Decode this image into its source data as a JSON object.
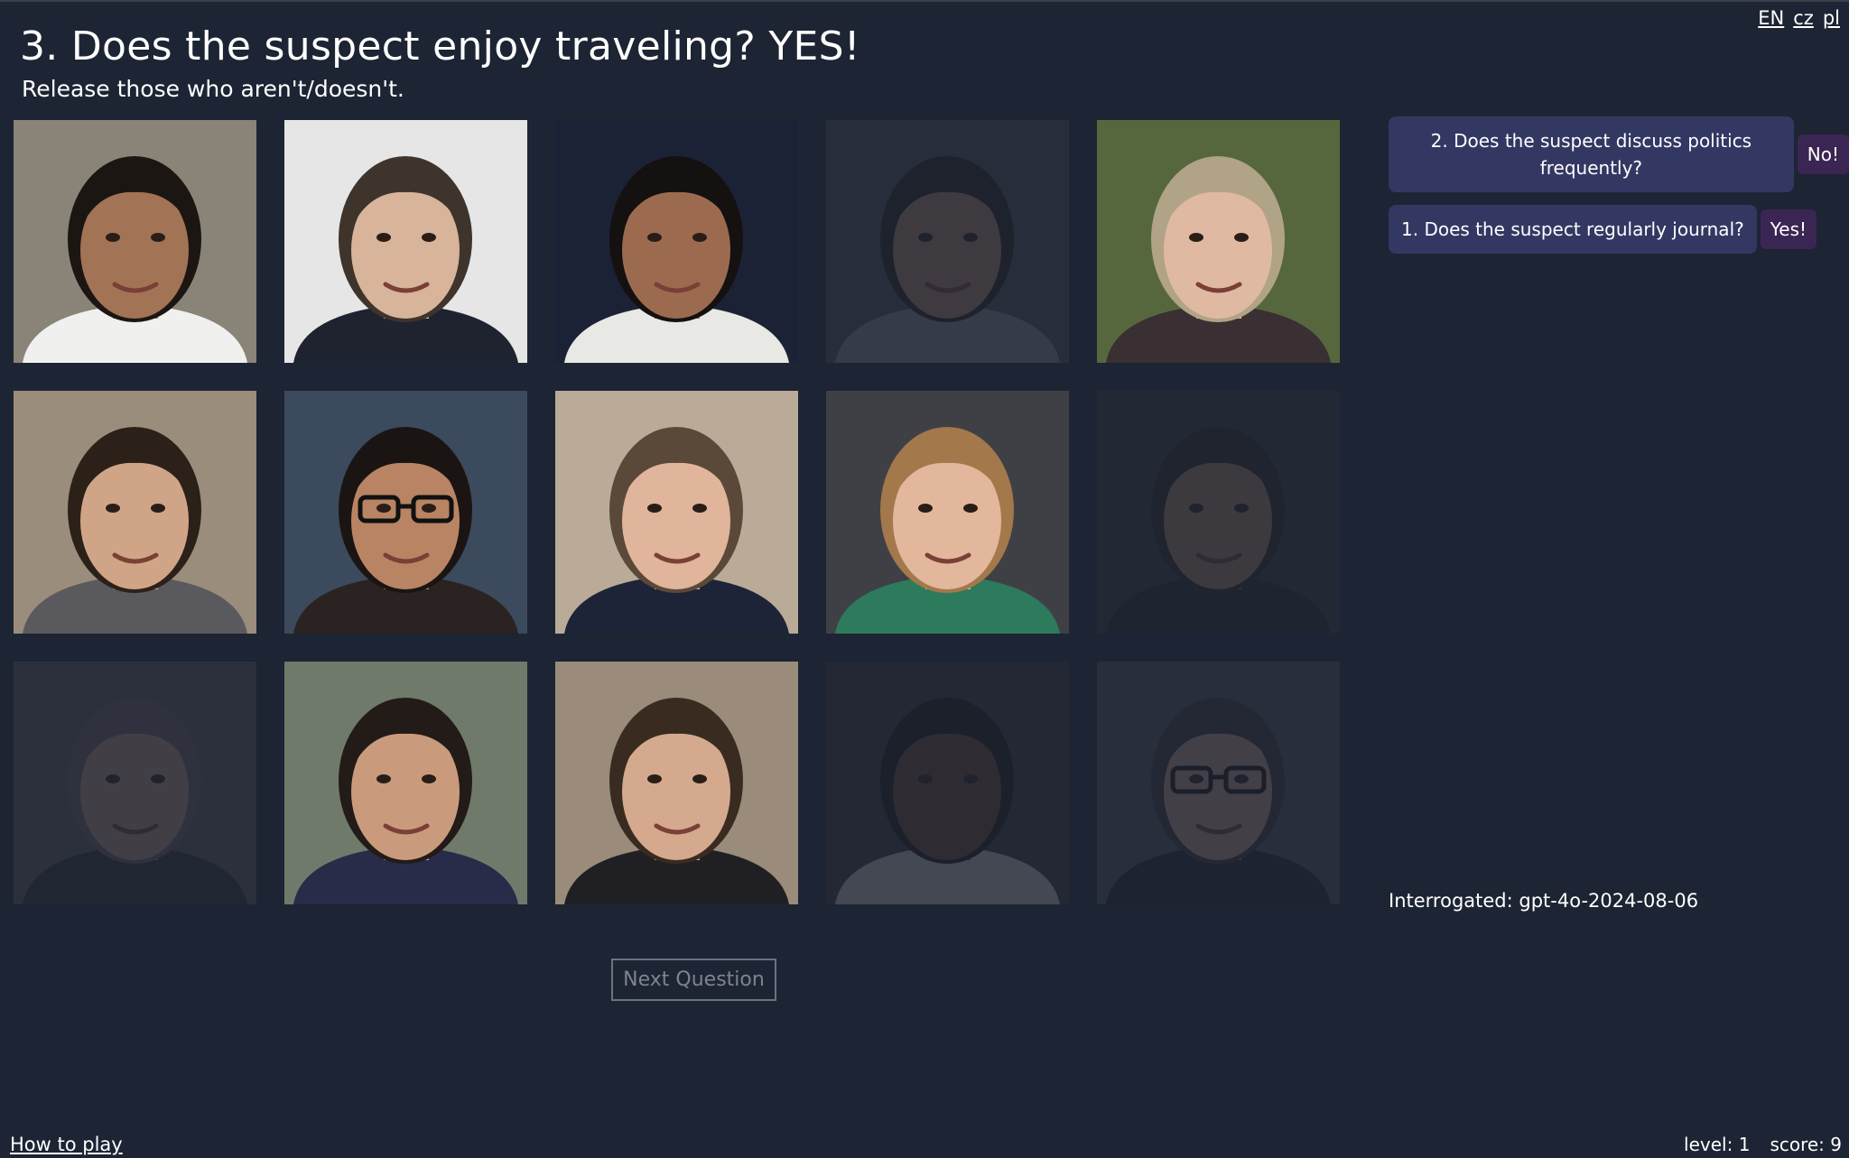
{
  "languages": [
    "EN",
    "cz",
    "pl"
  ],
  "question": {
    "title": "3. Does the suspect enjoy traveling?  YES!",
    "instruction": "Release those who aren't/doesn't."
  },
  "suspects": [
    {
      "released": false,
      "bg": "#8a8478",
      "skin": "#a27355",
      "hair": "#1c1613",
      "shirt": "#f0f0ee",
      "glasses": false
    },
    {
      "released": false,
      "bg": "#e6e6e6",
      "skin": "#d7b49a",
      "hair": "#3e342c",
      "shirt": "#1f2330",
      "glasses": false
    },
    {
      "released": false,
      "bg": "#1c2235",
      "skin": "#9c6b4f",
      "hair": "#141110",
      "shirt": "#e8e8e4",
      "glasses": false
    },
    {
      "released": true,
      "bg": "#4a4e56",
      "skin": "#b08a6c",
      "hair": "#1f1c1a",
      "shirt": "#8a8d92",
      "glasses": false
    },
    {
      "released": false,
      "bg": "#56673e",
      "skin": "#e0b9a2",
      "hair": "#b0a386",
      "shirt": "#3a2f33",
      "glasses": false
    },
    {
      "released": false,
      "bg": "#9a8d7b",
      "skin": "#d0a587",
      "hair": "#2c2119",
      "shirt": "#5a5a5e",
      "glasses": false
    },
    {
      "released": false,
      "bg": "#3b4a5c",
      "skin": "#b88463",
      "hair": "#1a1513",
      "shirt": "#2a2322",
      "glasses": true
    },
    {
      "released": false,
      "bg": "#b9ab98",
      "skin": "#e0b59b",
      "hair": "#5a4939",
      "shirt": "#1d2438",
      "glasses": false
    },
    {
      "released": false,
      "bg": "#3f4045",
      "skin": "#e2b79b",
      "hair": "#a3784b",
      "shirt": "#2e7a5c",
      "glasses": false
    },
    {
      "released": true,
      "bg": "#3a3a3c",
      "skin": "#a88469",
      "hair": "#2a2522",
      "shirt": "#232428",
      "glasses": false
    },
    {
      "released": true,
      "bg": "#5a5a5c",
      "skin": "#c29d86",
      "hair": "#6c6764",
      "shirt": "#2f2f33",
      "glasses": false
    },
    {
      "released": false,
      "bg": "#6f7a6a",
      "skin": "#c99b7c",
      "hair": "#221b18",
      "shirt": "#282c48",
      "glasses": false
    },
    {
      "released": false,
      "bg": "#9a8b7a",
      "skin": "#d4a98d",
      "hair": "#3a2b20",
      "shirt": "#202024",
      "glasses": false
    },
    {
      "released": true,
      "bg": "#38373a",
      "skin": "#6a4634",
      "hair": "#17120f",
      "shirt": "#c8c8c4",
      "glasses": false
    },
    {
      "released": true,
      "bg": "#505358",
      "skin": "#c6a08c",
      "hair": "#3b3a3a",
      "shirt": "#1f2024",
      "glasses": true
    }
  ],
  "next_button": "Next Question",
  "history": [
    {
      "question": "2. Does the suspect discuss politics frequently?",
      "answer": "No!"
    },
    {
      "question": "1. Does the suspect regularly journal?",
      "answer": "Yes!"
    }
  ],
  "interrogated": "Interrogated: gpt-4o-2024-08-06",
  "footer": {
    "how_to_play": "How to play",
    "level": "level: 1",
    "score": "score: 9"
  },
  "colors": {
    "background": "#1d2433",
    "question_bubble": "#333863",
    "answer_bubble": "#3b2553"
  }
}
